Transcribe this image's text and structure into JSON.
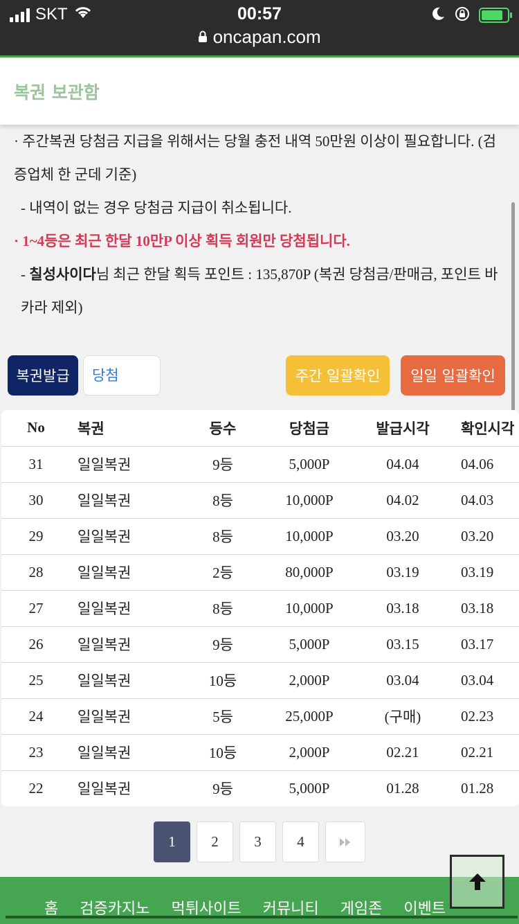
{
  "status_bar": {
    "carrier": "SKT",
    "time": "00:57",
    "url": "oncapan.com"
  },
  "header": {
    "title": "복권 보관함"
  },
  "notice": {
    "line1": "· 주간복권 당첨금 지급을 위해서는 당월 충전 내역 50만원 이상이 필요합니다. (검증업체 한 군데 기준)",
    "line2": "- 내역이 없는 경우 당첨금 지급이 취소됩니다.",
    "line3": "· 1~4등은 최근 한달 10만P 이상 획득 회원만 당첨됩니다.",
    "line4_user": "칠성사이다",
    "line4_rest": "님 최근 한달 획득 포인트 : 135,870P (복권 당첨금/판매금, 포인트 바카라 제외)"
  },
  "controls": {
    "issue_button": "복권발급",
    "filter_value": "당첨",
    "weekly_button": "주간 일괄확인",
    "daily_button": "일일 일괄확인"
  },
  "table": {
    "headers": [
      "No",
      "복권",
      "등수",
      "당첨금",
      "발급시각",
      "확인시각"
    ],
    "rows": [
      [
        "31",
        "일일복권",
        "9등",
        "5,000P",
        "04.04",
        "04.06"
      ],
      [
        "30",
        "일일복권",
        "8등",
        "10,000P",
        "04.02",
        "04.03"
      ],
      [
        "29",
        "일일복권",
        "8등",
        "10,000P",
        "03.20",
        "03.20"
      ],
      [
        "28",
        "일일복권",
        "2등",
        "80,000P",
        "03.19",
        "03.19"
      ],
      [
        "27",
        "일일복권",
        "8등",
        "10,000P",
        "03.18",
        "03.18"
      ],
      [
        "26",
        "일일복권",
        "9등",
        "5,000P",
        "03.15",
        "03.17"
      ],
      [
        "25",
        "일일복권",
        "10등",
        "2,000P",
        "03.04",
        "03.04"
      ],
      [
        "24",
        "일일복권",
        "5등",
        "25,000P",
        "(구매)",
        "02.23"
      ],
      [
        "23",
        "일일복권",
        "10등",
        "2,000P",
        "02.21",
        "02.21"
      ],
      [
        "22",
        "일일복권",
        "9등",
        "5,000P",
        "01.28",
        "01.28"
      ]
    ]
  },
  "pagination": {
    "pages": [
      "1",
      "2",
      "3",
      "4"
    ],
    "current": "1",
    "next_icon": "double-chevron-right-icon"
  },
  "bottom_nav": {
    "items": [
      "홈",
      "검증카지노",
      "먹튀사이트",
      "커뮤니티",
      "게임존",
      "이벤트"
    ]
  },
  "colors": {
    "brand_green": "#45a551",
    "issue_button": "#0f2565",
    "weekly_button": "#f5c036",
    "daily_button": "#e76a40",
    "alert_red": "#d43a56",
    "header_title": "#9bc49d"
  },
  "icons": {
    "back_to_top": "arrow-up-icon",
    "lock": "lock-icon",
    "wifi": "wifi-icon",
    "signal": "signal-icon",
    "moon": "moon-icon",
    "rotation_lock": "rotation-lock-icon",
    "battery": "battery-charging-icon"
  }
}
